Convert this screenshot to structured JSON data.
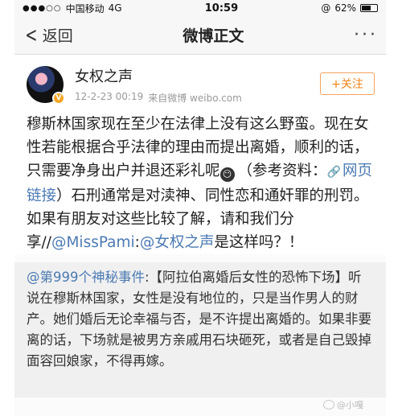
{
  "status_bar": {
    "signal_dots": "●●●○○",
    "carrier": "中国移动",
    "network": "4G",
    "time": "10:59",
    "icon_lock": "@",
    "battery_percent": "62%",
    "battery_level": 0.62
  },
  "nav": {
    "back_label": "返回",
    "title": "微博正文",
    "more_label": "···"
  },
  "post": {
    "user_name": "女权之声",
    "timestamp": "12-2-23 00:19",
    "source": "来自微博 weibo.com",
    "follow_label": "+关注",
    "body_part1": "穆斯林国家现在至少在法律上没有这么野蛮。现在女性若能根据合乎法律的理由而提出离婚，顺利的话，只需要净身出户并退还彩礼呢",
    "emoji": "😶",
    "body_part2": "（参考资料：",
    "link_text": "网页链接",
    "body_part3": "）石刑通常是对渎神、同性恋和通奸罪的刑罚。如果有朋友对这些比较了解，请和我们分享//",
    "mention1": "@MissPami",
    "body_part4": ":",
    "mention2": "@女权之声",
    "body_part5": "是这样吗？！"
  },
  "repost": {
    "mention": "@第999个神秘事件",
    "text": ":【阿拉伯离婚后女性的恐怖下场】听说在穆斯林国家，女性是没有地位的，只是当作男人的财产。她们婚后无论幸福与否，是不许提出离婚的。如果非要离的话，下场就是被男方亲戚用石块砸死，或者是自己毁掉面容回娘家，不得再嫁。"
  },
  "watermark": {
    "text": "@小嘎"
  },
  "colors": {
    "link": "#4c7ab3",
    "follow": "#f08419",
    "repost_bg": "#f0f0f0"
  }
}
